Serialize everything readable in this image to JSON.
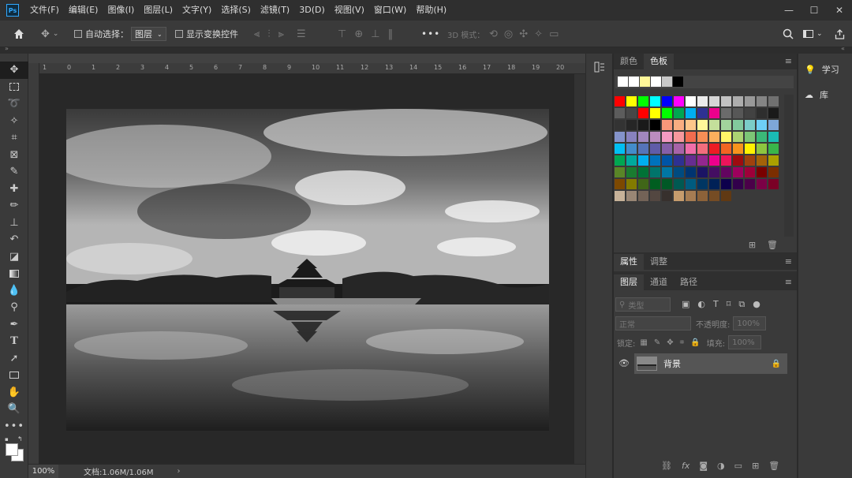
{
  "app": {
    "logo": "Ps"
  },
  "menu": [
    "文件(F)",
    "编辑(E)",
    "图像(I)",
    "图层(L)",
    "文字(Y)",
    "选择(S)",
    "滤镜(T)",
    "3D(D)",
    "视图(V)",
    "窗口(W)",
    "帮助(H)"
  ],
  "window_controls": {
    "min": "—",
    "max": "☐",
    "close": "✕"
  },
  "options": {
    "auto_select_label": "自动选择：",
    "auto_select_target": "图层",
    "show_transform_label": "显示变换控件",
    "more": "•••",
    "mode_3d_label": "3D 模式："
  },
  "ruler_ticks": [
    "1",
    "0",
    "1",
    "2",
    "3",
    "4",
    "5",
    "6",
    "7",
    "8",
    "9",
    "10",
    "11",
    "12",
    "13",
    "14",
    "15",
    "16",
    "17",
    "18",
    "19",
    "20"
  ],
  "status": {
    "zoom": "100%",
    "doc_size": "文档:1.06M/1.06M",
    "arrow": "›"
  },
  "color_panel": {
    "tabs": [
      "颜色",
      "色板"
    ],
    "active_tab": "色板"
  },
  "swatches": {
    "recent": [
      "#ffffff",
      "#ffffff",
      "#fff799",
      "#ffffff",
      "#c8c8c8",
      "#000000"
    ],
    "rows": [
      [
        "#ff0000",
        "#ffff00",
        "#00ff00",
        "#00ffff",
        "#0000ff",
        "#ff00ff",
        "#ffffff",
        "#ebebeb",
        "#d6d6d6",
        "#c2c2c2",
        "#adadad",
        "#999999",
        "#858585",
        "#707070"
      ],
      [
        "#5c5c5c",
        "#474747",
        "#ff0000",
        "#ffff00",
        "#00ff00",
        "#00a651",
        "#00aeef",
        "#2e3192",
        "#ec008c",
        "#6b6b6b",
        "#575757",
        "#424242",
        "#2e2e2e",
        "#1a1a1a"
      ],
      [
        "#333333",
        "#262626",
        "#1a1a1a",
        "#000000",
        "#f7977a",
        "#f9ad81",
        "#fdc68a",
        "#fff79a",
        "#c4df9b",
        "#a2d39c",
        "#82ca9d",
        "#7bcdc8",
        "#6ecff6",
        "#7ea7d8"
      ],
      [
        "#8493ca",
        "#8882be",
        "#a187be",
        "#bc8dbf",
        "#f49ac2",
        "#f6989d",
        "#f26c4f",
        "#f68e56",
        "#fbaf5d",
        "#fff568",
        "#acd372",
        "#7cc576",
        "#3bb878",
        "#1abbb4"
      ],
      [
        "#00bff3",
        "#438ccb",
        "#5574b9",
        "#605ca8",
        "#855fa8",
        "#a763a8",
        "#f06ea9",
        "#f26d7d",
        "#ed1c24",
        "#f26522",
        "#f7941d",
        "#fff200",
        "#8dc63f",
        "#39b54a"
      ],
      [
        "#00a651",
        "#00a99d",
        "#00aeef",
        "#0072bc",
        "#0054a6",
        "#2e3192",
        "#662d91",
        "#92278f",
        "#ec008c",
        "#ed145b",
        "#9e0b0f",
        "#a0410d",
        "#a36209",
        "#aba000"
      ],
      [
        "#598527",
        "#1a7b30",
        "#007236",
        "#00746b",
        "#0076a3",
        "#004b80",
        "#003471",
        "#1b1464",
        "#440e62",
        "#630460",
        "#9e005d",
        "#9e0039",
        "#790000",
        "#7b2e00"
      ],
      [
        "#7d4900",
        "#827b00",
        "#406618",
        "#005e20",
        "#005826",
        "#005952",
        "#005b7f",
        "#003663",
        "#002157",
        "#0d004c",
        "#32004b",
        "#4b0049",
        "#7b0046",
        "#7a0026"
      ],
      [
        "#c7b299",
        "#998675",
        "#736357",
        "#534741",
        "#37302d",
        "#c69c6d",
        "#a67c52",
        "#8c6239",
        "#754c24",
        "#603913"
      ]
    ]
  },
  "props_panel": {
    "tabs": [
      "属性",
      "调整"
    ],
    "active_tab": "属性"
  },
  "layers_panel": {
    "tabs": [
      "图层",
      "通道",
      "路径"
    ],
    "active_tab": "图层",
    "filter_label": "类型",
    "blend_mode": "正常",
    "opacity_label": "不透明度:",
    "opacity_value": "100%",
    "lock_label": "锁定:",
    "fill_label": "填充:",
    "fill_value": "100%",
    "layer_name": "背景"
  },
  "dock2": {
    "learn": "学习",
    "library": "库"
  }
}
